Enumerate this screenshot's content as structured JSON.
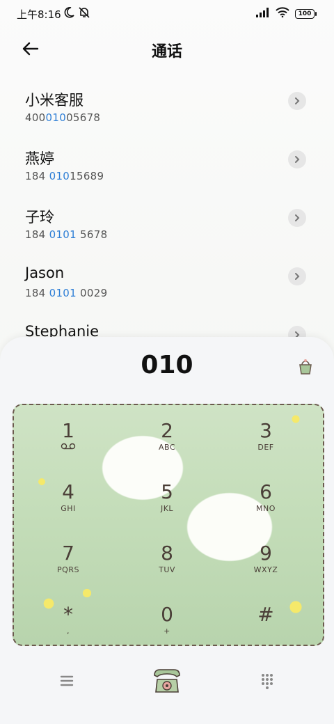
{
  "status": {
    "time": "上午8:16",
    "battery": "100"
  },
  "header": {
    "title": "通话"
  },
  "contacts": [
    {
      "name": "小米客服",
      "num_pre": "400",
      "num_hl": "010",
      "num_post": "05678"
    },
    {
      "name": "燕婷",
      "num_pre": "184 ",
      "num_hl": "010",
      "num_post": "15689"
    },
    {
      "name": "子玲",
      "num_pre": "184 ",
      "num_hl": "0101",
      "num_post": " 5678"
    },
    {
      "name": "Jason",
      "num_pre": "184 ",
      "num_hl": "0101",
      "num_post": " 0029"
    },
    {
      "name": "Stephanie",
      "num_pre": "",
      "num_hl": "",
      "num_post": ""
    }
  ],
  "dialer": {
    "number": "010",
    "keys": [
      {
        "digit": "1",
        "letters": "ꝏ"
      },
      {
        "digit": "2",
        "letters": "ABC"
      },
      {
        "digit": "3",
        "letters": "DEF"
      },
      {
        "digit": "4",
        "letters": "GHI"
      },
      {
        "digit": "5",
        "letters": "JKL"
      },
      {
        "digit": "6",
        "letters": "MNO"
      },
      {
        "digit": "7",
        "letters": "PQRS"
      },
      {
        "digit": "8",
        "letters": "TUV"
      },
      {
        "digit": "9",
        "letters": "WXYZ"
      },
      {
        "digit": "*",
        "letters": ","
      },
      {
        "digit": "0",
        "letters": "+"
      },
      {
        "digit": "#",
        "letters": ""
      }
    ]
  },
  "icons": {
    "back": "arrow-left-icon",
    "chevron": "chevron-right-icon",
    "delete": "delete-basket-icon",
    "menu": "menu-icon",
    "call": "telephone-icon",
    "keypad": "keypad-grid-icon"
  },
  "colors": {
    "highlight": "#2f7fd6",
    "keypad_border": "#6b5a4e",
    "keypad_text": "#4a3e37"
  }
}
